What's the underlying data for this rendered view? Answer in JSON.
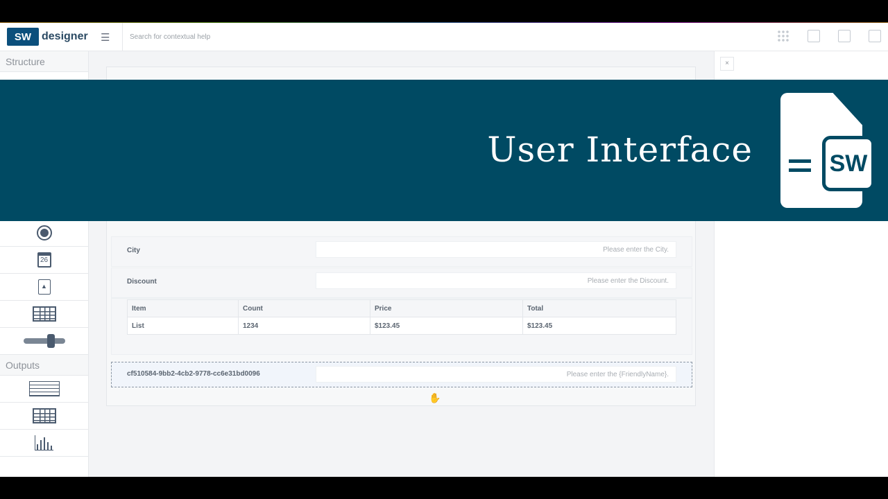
{
  "header": {
    "logo_mark": "SW",
    "logo_text": "designer",
    "search_placeholder": "Search for contextual help"
  },
  "sidebar": {
    "structure_title": "Structure",
    "outputs_title": "Outputs",
    "calendar_day": "26"
  },
  "form": {
    "rows": [
      {
        "label": "City",
        "placeholder": "Please enter the City."
      },
      {
        "label": "Discount",
        "placeholder": "Please enter the Discount."
      }
    ],
    "table": {
      "headers": [
        "Item",
        "Count",
        "Price",
        "Total"
      ],
      "rows": [
        [
          "List",
          "1234",
          "$123.45",
          "$123.45"
        ]
      ]
    },
    "selected_row": {
      "label": "cf510584-9bb2-4cb2-9778-cc6e31bd0096",
      "placeholder": "Please enter the {FriendlyName}."
    }
  },
  "panel": {
    "close_label": "×"
  },
  "banner": {
    "title": "User Interface",
    "logo_mark": "SW",
    "bg_color": "#004a63"
  }
}
